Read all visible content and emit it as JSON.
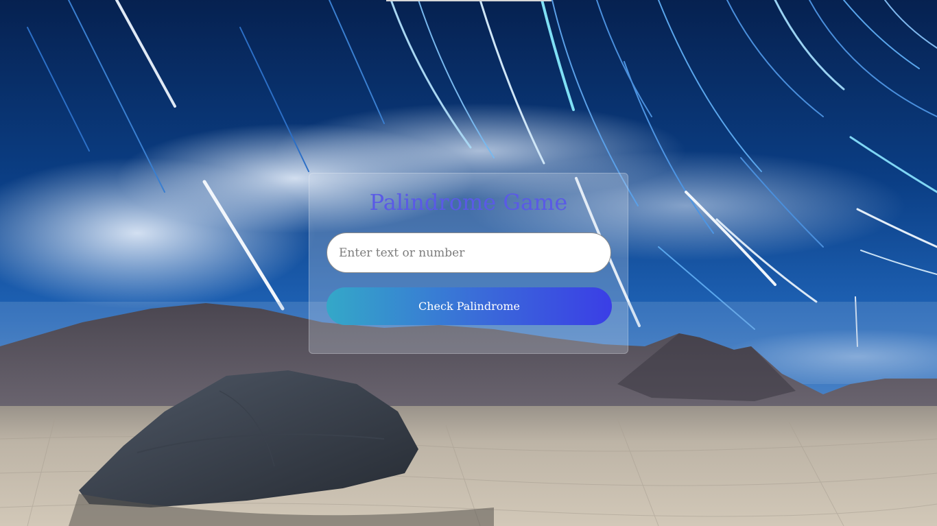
{
  "title": "Palindrome Game",
  "input": {
    "value": "",
    "placeholder": "Enter text or number"
  },
  "button": {
    "label": "Check Palindrome"
  },
  "colors": {
    "title": "#5a5ae6",
    "button_gradient_start": "#34a8c8",
    "button_gradient_end": "#3a3ee6"
  }
}
